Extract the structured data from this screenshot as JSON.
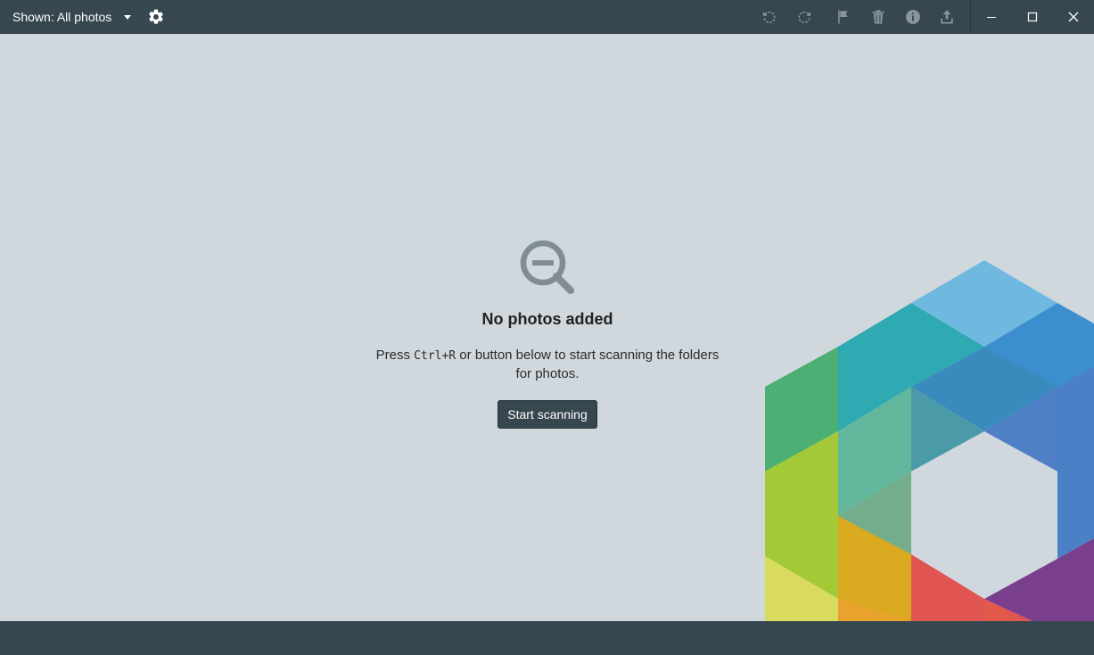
{
  "toolbar": {
    "filter_label": "Shown: All photos",
    "filter_icon": "chevron-down-icon",
    "settings_icon": "gear-icon",
    "tools": [
      {
        "name": "rotate-left-icon"
      },
      {
        "name": "rotate-right-icon"
      },
      {
        "name": "flag-icon"
      },
      {
        "name": "trash-icon"
      },
      {
        "name": "info-icon"
      },
      {
        "name": "share-icon"
      }
    ]
  },
  "window_controls": {
    "minimize_icon": "minimize-icon",
    "maximize_icon": "maximize-icon",
    "close_icon": "close-icon"
  },
  "empty_state": {
    "icon": "zoom-out-icon",
    "title": "No photos added",
    "text_before": "Press ",
    "shortcut": "Ctrl+R",
    "text_after": " or button below to start scanning the folders for photos.",
    "button_label": "Start scanning"
  },
  "colors": {
    "toolbar_bg": "#37474f",
    "content_bg": "#d0d8de",
    "accent": "#37474f"
  }
}
